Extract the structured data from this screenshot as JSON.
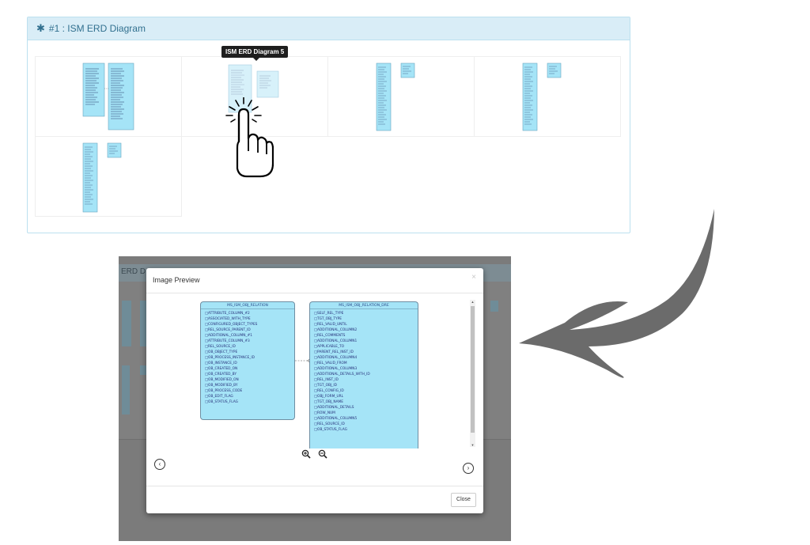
{
  "panel": {
    "title": "#1 : ISM ERD Diagram",
    "icon": "gear-icon"
  },
  "tooltip": {
    "text": "ISM ERD Diagram 5"
  },
  "shot": {
    "background_title": "ERD D"
  },
  "modal": {
    "title": "Image Preview",
    "close_x": "×",
    "close_button": "Close",
    "left_table": {
      "title": "MS_ISM_OBJ_RELATION",
      "columns": [
        "ATTRIBUTE_COLUMN_#2",
        "ASSOCIATED_WITH_TYPE",
        "CONFIGURED_OBJECT_TYPES",
        "REL_SOURCE_PARENT_ID",
        "ADDITIONAL_COLUMN_#1",
        "ATTRIBUTE_COLUMN_#3",
        "REL_SOURCE_ID",
        "OB_OBJECT_TYPE",
        "OB_PROCESS_INSTANCE_ID",
        "OB_INSTANCE_ID",
        "OB_CREATED_ON",
        "OB_CREATED_BY",
        "OB_MODIFIED_ON",
        "OB_MODIFIED_BY",
        "OB_PROCESS_CODE",
        "OB_EDIT_FLAG",
        "OB_STATUS_FLAG"
      ]
    },
    "right_table": {
      "title": "MS_ISM_OBJ_RELATION_DRE",
      "columns": [
        "SELF_REL_TYPE",
        "TGT_OBJ_TYPE",
        "REL_VALID_UNTIL",
        "ADDITIONAL_COLUMN2",
        "REL_COMMENTS",
        "ADDITIONAL_COLUMN1",
        "APPLICABLE_TO",
        "PARENT_REL_INST_ID",
        "ADDITIONAL_COLUMN4",
        "REL_VALID_FROM",
        "ADDITIONAL_COLUMN3",
        "ADDITIONAL_DETAILS_WITH_ID",
        "REL_INST_ID",
        "TGT_OBJ_ID",
        "REL_CONFIG_ID",
        "OBJ_FORM_URL",
        "TGT_OBJ_NAME",
        "ADDITIONAL_DETAILS",
        "ROW_NUM",
        "ADDITIONAL_COLUMN5",
        "REL_SOURCE_ID",
        "OB_STATUS_FLAG"
      ]
    },
    "zoom_in_icon": "zoom-in-icon",
    "zoom_out_icon": "zoom-out-icon",
    "prev_icon": "chevron-left-icon",
    "next_icon": "chevron-right-icon"
  },
  "colors": {
    "table_fill": "#a5e4f7",
    "panel_head": "#d9edf7",
    "panel_text": "#31708f"
  }
}
